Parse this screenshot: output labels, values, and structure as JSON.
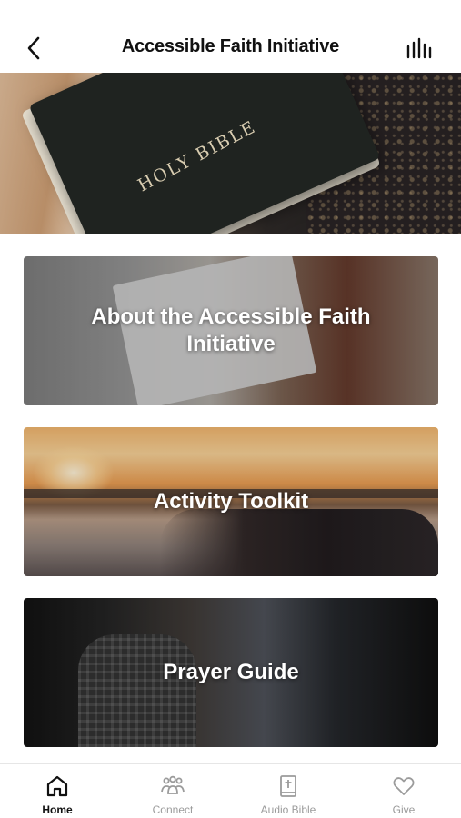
{
  "header": {
    "title": "Accessible Faith Initiative",
    "back_icon": "chevron-left-icon",
    "audio_icon": "audio-bars-icon"
  },
  "hero": {
    "book_text": "HOLY BIBLE"
  },
  "cards": [
    {
      "label": "About the Accessible Faith Initiative"
    },
    {
      "label": "Activity Toolkit"
    },
    {
      "label": "Prayer Guide"
    }
  ],
  "tabbar": {
    "active_color": "#111111",
    "inactive_color": "#9b9b9b",
    "tabs": [
      {
        "label": "Home",
        "icon": "home-icon",
        "active": true
      },
      {
        "label": "Connect",
        "icon": "people-icon",
        "active": false
      },
      {
        "label": "Audio Bible",
        "icon": "bible-icon",
        "active": false
      },
      {
        "label": "Give",
        "icon": "heart-icon",
        "active": false
      }
    ]
  }
}
